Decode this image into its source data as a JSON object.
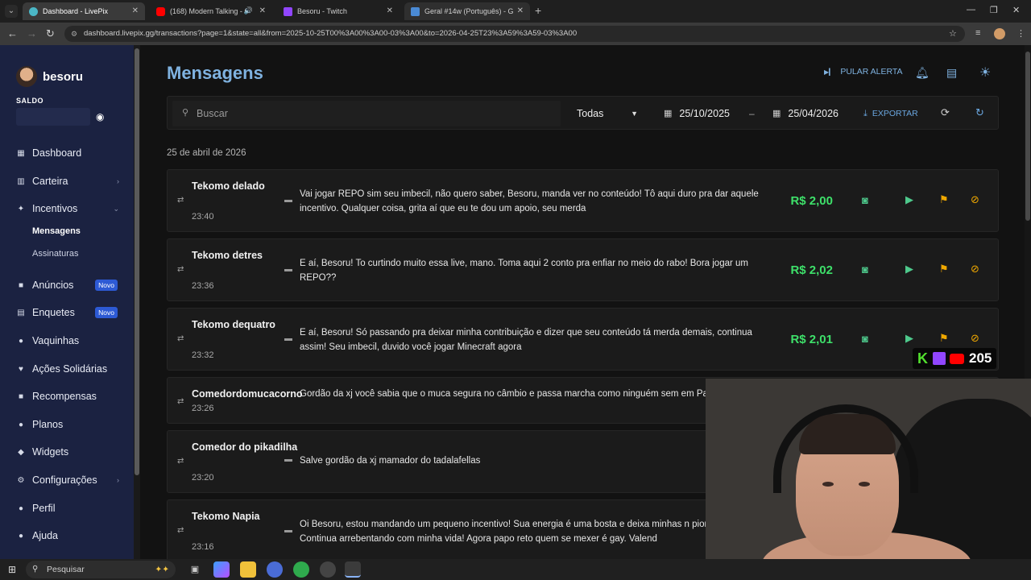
{
  "browser": {
    "tabs": [
      {
        "title": "Dashboard - LivePix",
        "active": true,
        "color": "#4bb7c6"
      },
      {
        "title": "(168) Modern Talking - Che",
        "active": false,
        "color": "#ff0000"
      },
      {
        "title": "Besoru - Twitch",
        "active": false,
        "color": "#9146ff"
      },
      {
        "title": "Geral #14w (Português) - Garti",
        "active": false,
        "color": "#4a8ad4"
      }
    ],
    "url": "dashboard.livepix.gg/transactions?page=1&state=all&from=2025-10-25T00%3A00%3A00-03%3A00&to=2026-04-25T23%3A59%3A59-03%3A00"
  },
  "sidebar": {
    "username": "besoru",
    "saldo_label": "SALDO",
    "items": [
      {
        "label": "Dashboard",
        "icon": "dashboard-icon"
      },
      {
        "label": "Carteira",
        "icon": "wallet-icon"
      },
      {
        "label": "Incentivos",
        "icon": "incentives-icon"
      },
      {
        "label": "Anúncios",
        "icon": "ads-icon",
        "badge": "Novo"
      },
      {
        "label": "Enquetes",
        "icon": "polls-icon",
        "badge": "Novo"
      },
      {
        "label": "Vaquinhas",
        "icon": "crowdfund-icon"
      },
      {
        "label": "Ações Solidárias",
        "icon": "charity-icon"
      },
      {
        "label": "Recompensas",
        "icon": "rewards-icon"
      },
      {
        "label": "Planos",
        "icon": "plans-icon"
      },
      {
        "label": "Widgets",
        "icon": "widgets-icon"
      },
      {
        "label": "Configurações",
        "icon": "settings-icon"
      },
      {
        "label": "Perfil",
        "icon": "profile-icon"
      },
      {
        "label": "Ajuda",
        "icon": "help-icon"
      }
    ],
    "subitems": [
      {
        "label": "Mensagens",
        "active": true
      },
      {
        "label": "Assinaturas",
        "active": false
      }
    ]
  },
  "main": {
    "title": "Mensagens",
    "skip_alert_label": "PULAR ALERTA",
    "filters": {
      "search_placeholder": "Buscar",
      "status": "Todas",
      "date_from": "25/10/2025",
      "date_sep": "–",
      "date_to": "25/04/2026",
      "export_label": "EXPORTAR"
    },
    "date_group": "25 de abril de 2026",
    "messages": [
      {
        "name": "Tekomo delado",
        "time": "23:40",
        "text": "Vai jogar REPO sim seu imbecil, não quero saber, Besoru, manda ver no conteúdo! Tô aqui duro pra dar aquele incentivo. Qualquer coisa, grita aí que eu te dou um apoio, seu merda",
        "amount": "R$ 2,00"
      },
      {
        "name": "Tekomo detres",
        "time": "23:36",
        "text": "E aí, Besoru! To curtindo muito essa live, mano. Toma aqui 2 conto pra enfiar no meio do rabo! Bora jogar um REPO??",
        "amount": "R$ 2,02"
      },
      {
        "name": "Tekomo dequatro",
        "time": "23:32",
        "text": "E aí, Besoru! Só passando pra deixar minha contribuição e dizer que seu conteúdo tá merda demais, continua assim! Seu imbecil, duvido você jogar Minecraft agora",
        "amount": "R$ 2,01"
      },
      {
        "name": "Comedordomucacorno",
        "time": "23:26",
        "text": "Gordão da xj você sabia que o muca segura no câmbio e passa marcha como ninguém sem em Pablete",
        "amount": ""
      },
      {
        "name": "Comedor do pikadilha",
        "time": "23:20",
        "text": "Salve gordão da xj mamador do tadalafellas",
        "amount": ""
      },
      {
        "name": "Tekomo Napia",
        "time": "23:16",
        "text": "Oi Besoru, estou mandando um pequeno incentivo! Sua energia é uma bosta e deixa minhas n piores. Continua arrebentando com minha vida! Agora papo reto quem se mexer é gay. Valend",
        "amount": ""
      }
    ]
  },
  "overlay": {
    "count": "205",
    "k_label": "K"
  },
  "taskbar": {
    "search_placeholder": "Pesquisar"
  }
}
